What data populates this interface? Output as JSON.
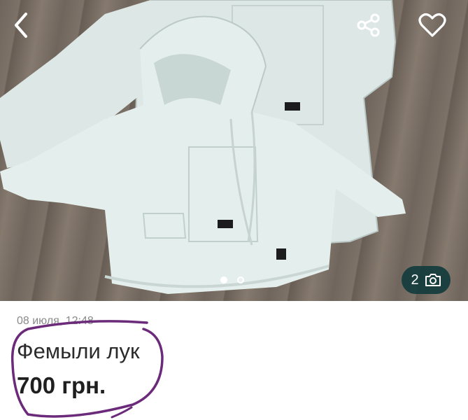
{
  "listing": {
    "date": "08 июля, 12:48",
    "title": "Фемыли лук",
    "price": "700 грн."
  },
  "gallery": {
    "photo_count": "2",
    "total_photos": 2,
    "active_index": 1
  },
  "icons": {
    "back": "chevron-left-icon",
    "share": "share-icon",
    "favorite": "heart-outline-icon",
    "camera": "camera-icon"
  },
  "colors": {
    "badge_background": "#143c3c",
    "annotation_stroke": "#6b2a7a",
    "text_primary": "#1f1f1f",
    "text_secondary": "#8a8a8a"
  }
}
